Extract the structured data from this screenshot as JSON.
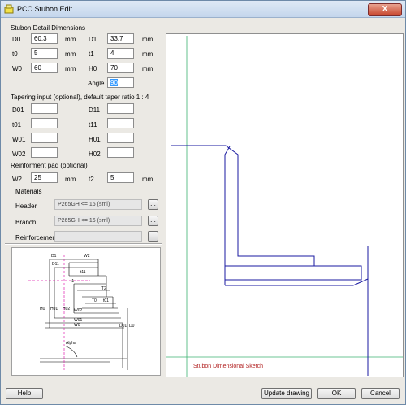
{
  "window": {
    "title": "PCC Stubon Edit",
    "close_glyph": "X"
  },
  "sections": {
    "detail": "Stubon Detail Dimensions",
    "taper": "Tapering input (optional), default taper ratio 1 : 4",
    "pad": "Reinforment pad (optional)",
    "materials": "Materials"
  },
  "unit": "mm",
  "fields": {
    "d0": {
      "label": "D0",
      "value": "60.3"
    },
    "d1": {
      "label": "D1",
      "value": "33.7"
    },
    "t0": {
      "label": "t0",
      "value": "5"
    },
    "t1": {
      "label": "t1",
      "value": "4"
    },
    "w0": {
      "label": "W0",
      "value": "60"
    },
    "h0": {
      "label": "H0",
      "value": "70"
    },
    "angle": {
      "label": "Angle",
      "value": "90"
    },
    "d01": {
      "label": "D01",
      "value": ""
    },
    "d11": {
      "label": "D11",
      "value": ""
    },
    "t01": {
      "label": "t01",
      "value": ""
    },
    "t11": {
      "label": "t11",
      "value": ""
    },
    "w01": {
      "label": "W01",
      "value": ""
    },
    "h01": {
      "label": "H01",
      "value": ""
    },
    "w02": {
      "label": "W02",
      "value": ""
    },
    "h02": {
      "label": "H02",
      "value": ""
    },
    "w2": {
      "label": "W2",
      "value": "25"
    },
    "t2": {
      "label": "t2",
      "value": "5"
    }
  },
  "materials": {
    "header": {
      "label": "Header",
      "value": "P265GH <= 16 (sml)"
    },
    "branch": {
      "label": "Branch",
      "value": "P265GH <= 16 (sml)"
    },
    "reinforcement": {
      "label": "Reinforcement",
      "value": ""
    },
    "browse_label": "..."
  },
  "sketch": {
    "caption": "Stubon Dimensional Sketch",
    "line_color": "#1a1aa0",
    "caption_color": "#b22222",
    "guide_color": "#3cb371"
  },
  "diagram": {
    "labels": {
      "d1": "D1",
      "w2": "W2",
      "d11": "D11",
      "t11": "t11",
      "t1": "t1",
      "t2": "T2",
      "t0": "T0",
      "t01": "t01",
      "h0": "H0",
      "h01": "H01",
      "h02": "H02",
      "w02": "W02",
      "w01": "W01",
      "w0": "W0",
      "alpha": "Alpha",
      "d01": "D01",
      "d0": "D0"
    }
  },
  "buttons": {
    "help": "Help",
    "update": "Update drawing",
    "ok": "OK",
    "cancel": "Cancel"
  }
}
